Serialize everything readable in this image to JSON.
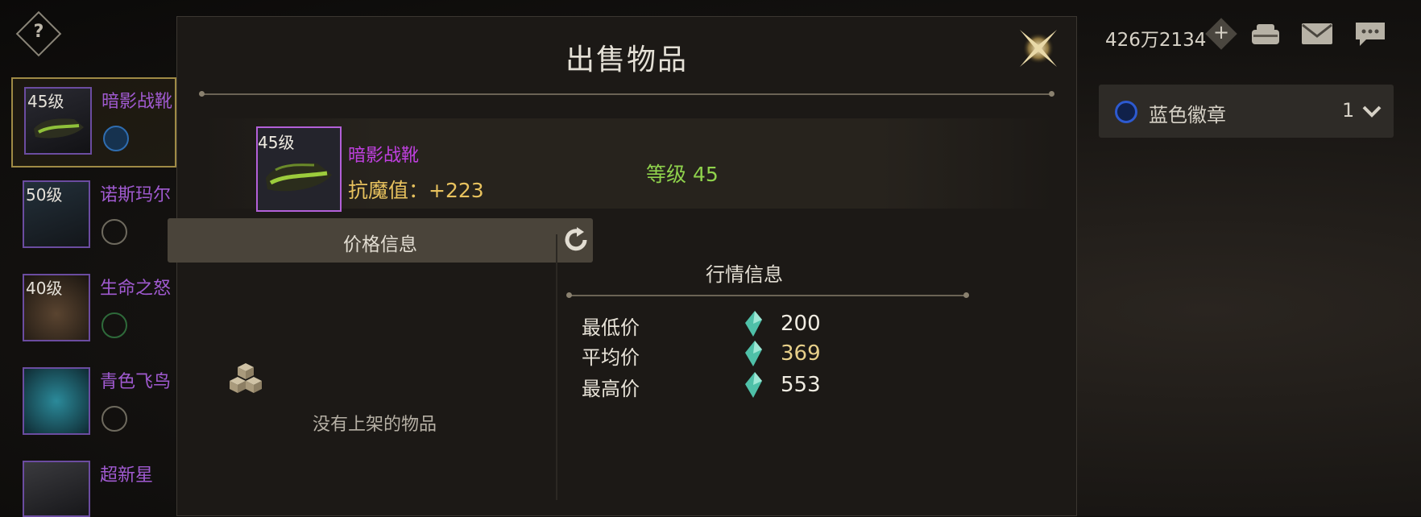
{
  "topbar": {
    "help_symbol": "?",
    "currency": "426万2134",
    "plus": "+",
    "icons": [
      "shop-icon",
      "mail-icon",
      "chat-icon"
    ]
  },
  "item_list": [
    {
      "level": "45级",
      "name": "暗影战靴",
      "selected": true
    },
    {
      "level": "50级",
      "name": "诺斯玛尔",
      "selected": false
    },
    {
      "level": "40级",
      "name": "生命之怒",
      "selected": false
    },
    {
      "level": "",
      "name": "青色飞鸟",
      "selected": false
    },
    {
      "level": "",
      "name": "超新星",
      "selected": false
    }
  ],
  "dialog": {
    "title": "出售物品",
    "item": {
      "level": "45级",
      "name": "暗影战靴",
      "stat": "抗魔值：+223",
      "grade": "等级 45"
    },
    "price_panel": {
      "title": "价格信息",
      "empty_text": "没有上架的物品"
    },
    "market_panel": {
      "title": "行情信息",
      "rows": [
        {
          "label": "最低价",
          "value": "200"
        },
        {
          "label": "平均价",
          "value": "369"
        },
        {
          "label": "最高价",
          "value": "553"
        }
      ]
    }
  },
  "right_panel": {
    "filter_label": "蓝色徽章",
    "filter_count": "1"
  },
  "colors": {
    "rare_purple": "#a05ad0",
    "stat_gold": "#e8c25e",
    "level_green": "#8fd24c",
    "avg_price_gold": "#e8d08a"
  }
}
